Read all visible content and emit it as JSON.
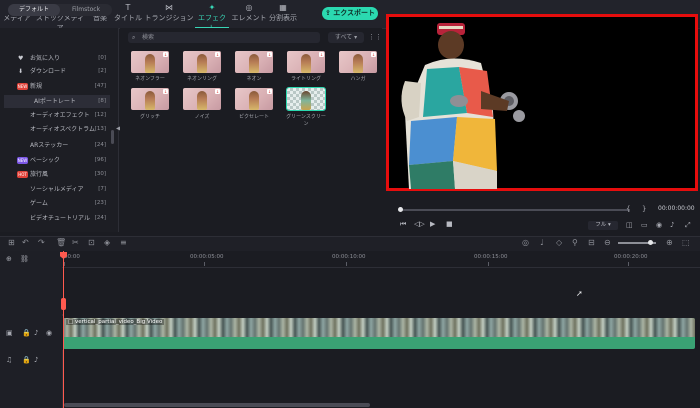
{
  "toolbar": {
    "tabs": [
      {
        "label": "メディア",
        "icon": "folder-icon"
      },
      {
        "label": "ストックメディア",
        "icon": "cloud-icon"
      },
      {
        "label": "音楽",
        "icon": "music-icon"
      },
      {
        "label": "タイトル",
        "icon": "text-icon"
      },
      {
        "label": "トランジション",
        "icon": "transition-icon"
      },
      {
        "label": "エフェクト",
        "icon": "sparkle-icon"
      },
      {
        "label": "エレメント",
        "icon": "element-icon"
      },
      {
        "label": "分割表示",
        "icon": "split-icon"
      }
    ],
    "active_tab": "エフェクト",
    "export_label": "エクスポート",
    "accent_color": "#2bd9b0"
  },
  "library": {
    "segments": [
      "デフォルト",
      "Filmstock"
    ],
    "categories": [
      {
        "label": "お気に入り",
        "count": "[0]"
      },
      {
        "label": "ダウンロード",
        "count": "[2]"
      },
      {
        "label": "新規",
        "count": "[47]",
        "badge": "NEW"
      },
      {
        "label": "AIポートレート",
        "count": "[8]"
      },
      {
        "label": "オーディオエフェクト",
        "count": "[12]"
      },
      {
        "label": "オーディオスペクトラム",
        "count": "[13]"
      },
      {
        "label": "ARステッカー",
        "count": "[24]"
      },
      {
        "label": "ベーシック",
        "count": "[96]",
        "badge": "NEW"
      },
      {
        "label": "旅行風",
        "count": "[30]",
        "badge": "HOT"
      },
      {
        "label": "ソーシャルメディア",
        "count": "[7]"
      },
      {
        "label": "ゲーム",
        "count": "[23]"
      },
      {
        "label": "ビデオチュートリアル",
        "count": "[24]"
      }
    ],
    "selected_category": "AIポートレート"
  },
  "effects": {
    "search_placeholder": "検索",
    "filter_label": "すべて ▾",
    "items": [
      {
        "label": "ネオンフラー"
      },
      {
        "label": "ネオンリング"
      },
      {
        "label": "ネオン"
      },
      {
        "label": "ライトリング"
      },
      {
        "label": "ハンガ"
      },
      {
        "label": "グリッチ"
      },
      {
        "label": "ノイズ"
      },
      {
        "label": "ピクセレート"
      },
      {
        "label": "グリーンスクリーン"
      }
    ]
  },
  "preview": {
    "timecode": "00:00:00:00",
    "quality_label": "フル",
    "frame_color": "#e60d0d"
  },
  "timeline": {
    "ruler_labels": [
      "00:00",
      "00:00:05:00",
      "00:00:10:00",
      "00:00:15:00",
      "00:00:20:00"
    ],
    "clip_title": "□ vertical_partial_video_Big Video"
  }
}
